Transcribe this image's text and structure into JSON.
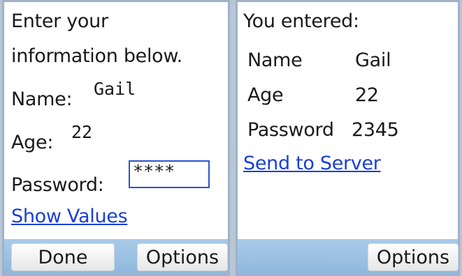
{
  "left": {
    "prompt_line1": "Enter your",
    "prompt_line2": "information below.",
    "name_label": "Name:",
    "name_value": "Gail",
    "age_label": "Age:",
    "age_value": "22",
    "password_label": "Password:",
    "password_value": "****",
    "show_values_link": "Show Values",
    "softkey_left": "Done",
    "softkey_right": "Options"
  },
  "right": {
    "heading": "You entered:",
    "rows": [
      {
        "label": "Name",
        "value": "Gail"
      },
      {
        "label": "Age",
        "value": "22"
      },
      {
        "label": "Password",
        "value": "2345"
      }
    ],
    "send_link": "Send to Server",
    "softkey_right": "Options"
  }
}
